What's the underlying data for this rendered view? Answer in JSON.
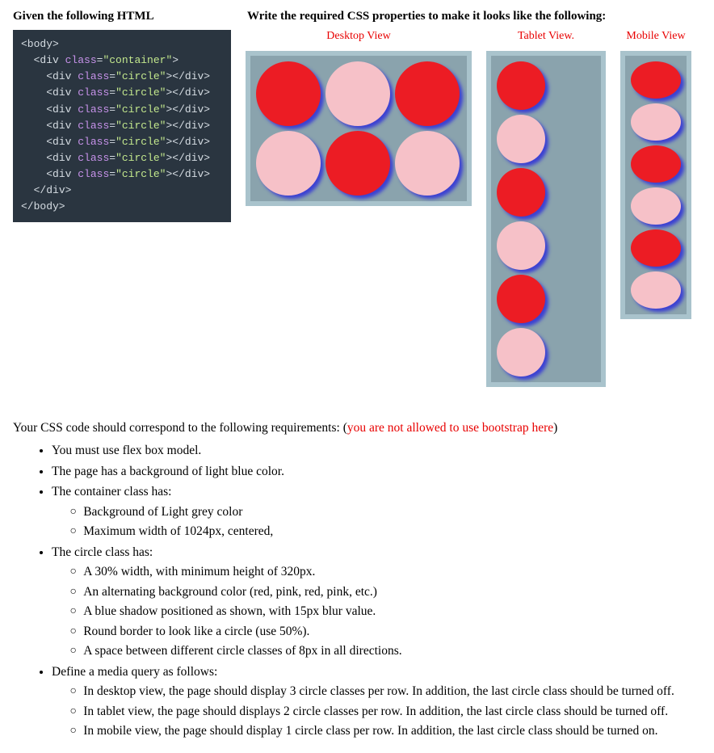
{
  "header": {
    "left": "Given the following HTML",
    "right": "Write the required CSS properties to make it looks like the following:"
  },
  "code": {
    "line1_open": "<body>",
    "line2_open": "<div ",
    "line2_attr": "class",
    "line2_eq": "=",
    "line2_val": "\"container\"",
    "line2_close": ">",
    "circle_open": "<div ",
    "circle_attr": "class",
    "circle_eq": "=",
    "circle_val": "\"circle\"",
    "circle_close": "></div>",
    "div_close": "</div>",
    "body_close": "</body>"
  },
  "views": {
    "desktop": "Desktop View",
    "tablet": "Tablet View.",
    "mobile": "Mobile View"
  },
  "requirements": {
    "intro_a": "Your CSS code should correspond to the following requirements: (",
    "intro_b": "you are not allowed to use bootstrap here",
    "intro_c": ")",
    "b1": "You must use flex box model.",
    "b2": "The page has a background of light blue color.",
    "b3": "The container class has:",
    "b3_1": "Background of Light grey color",
    "b3_2": "Maximum width of 1024px, centered,",
    "b4": "The circle class has:",
    "b4_1": "A 30% width, with minimum height of 320px.",
    "b4_2": "An alternating background color (red, pink, red, pink, etc.)",
    "b4_3": "A blue shadow positioned as shown, with 15px blur value.",
    "b4_4": "Round border to look like a circle (use 50%).",
    "b4_5": "A space between different circle classes of 8px in all directions.",
    "b5": "Define a media query as follows:",
    "b5_1": "In desktop view, the page should display 3 circle classes per row. In addition, the last circle class should be turned off.",
    "b5_2": "In tablet view, the page should displays 2 circle classes per row. In addition, the last circle class should be turned off.",
    "b5_3": "In mobile view, the page should display 1 circle class per row. In addition, the last circle class should be turned on."
  }
}
